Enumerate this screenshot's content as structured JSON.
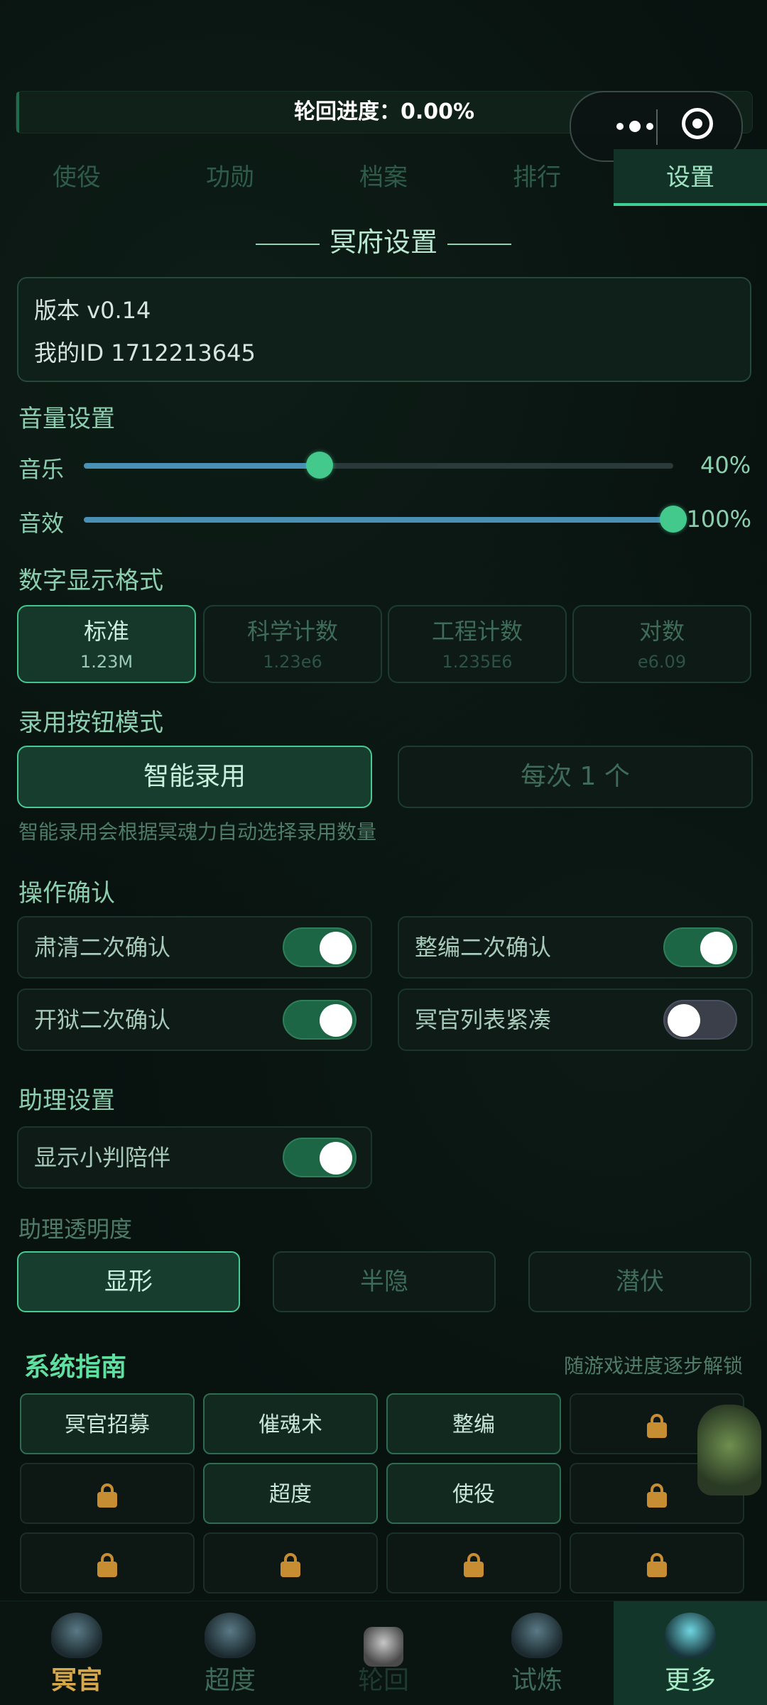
{
  "progress": {
    "label": "轮回进度：0.00%",
    "value": 0.0
  },
  "tabs": [
    {
      "label": "使役"
    },
    {
      "label": "功勋"
    },
    {
      "label": "档案"
    },
    {
      "label": "排行"
    },
    {
      "label": "设置"
    }
  ],
  "section_title": "冥府设置",
  "info": {
    "version": "版本 v0.14",
    "id": "我的ID 1712213645"
  },
  "volume": {
    "title": "音量设置",
    "music": {
      "label": "音乐",
      "percent": "40%",
      "value": 0.4
    },
    "sfx": {
      "label": "音效",
      "percent": "100%",
      "value": 1.0
    }
  },
  "number_format": {
    "title": "数字显示格式",
    "options": [
      {
        "name": "标准",
        "sample": "1.23M"
      },
      {
        "name": "科学计数",
        "sample": "1.23e6"
      },
      {
        "name": "工程计数",
        "sample": "1.235E6"
      },
      {
        "name": "对数",
        "sample": "e6.09"
      }
    ],
    "selected": "标准"
  },
  "hire_mode": {
    "title": "录用按钮模式",
    "options": [
      "智能录用",
      "每次 1 个"
    ],
    "selected": "智能录用",
    "hint": "智能录用会根据冥魂力自动选择录用数量"
  },
  "confirm": {
    "title": "操作确认",
    "items": [
      {
        "label": "肃清二次确认",
        "on": true
      },
      {
        "label": "整编二次确认",
        "on": true
      },
      {
        "label": "开狱二次确认",
        "on": true
      },
      {
        "label": "冥官列表紧凑",
        "on": false
      }
    ]
  },
  "assistant": {
    "title": "助理设置",
    "companion": {
      "label": "显示小判陪伴",
      "on": true
    },
    "opacity_title": "助理透明度",
    "opacity_options": [
      "显形",
      "半隐",
      "潜伏"
    ],
    "selected": "显形"
  },
  "guide": {
    "title": "系统指南",
    "subtitle": "随游戏进度逐步解锁",
    "items": [
      {
        "label": "冥官招募",
        "locked": false
      },
      {
        "label": "催魂术",
        "locked": false
      },
      {
        "label": "整编",
        "locked": false
      },
      {
        "label": "",
        "locked": true
      },
      {
        "label": "",
        "locked": true
      },
      {
        "label": "超度",
        "locked": false
      },
      {
        "label": "使役",
        "locked": false
      },
      {
        "label": "",
        "locked": true
      },
      {
        "label": "",
        "locked": true
      },
      {
        "label": "",
        "locked": true
      },
      {
        "label": "",
        "locked": true
      },
      {
        "label": "",
        "locked": true
      }
    ]
  },
  "bottom_nav": [
    {
      "label": "冥官",
      "icon": "ghost-icon"
    },
    {
      "label": "超度",
      "icon": "lantern-icon"
    },
    {
      "label": "轮回",
      "icon": "lock-icon"
    },
    {
      "label": "试炼",
      "icon": "flame-icon"
    },
    {
      "label": "更多",
      "icon": "spirit-icon"
    }
  ]
}
